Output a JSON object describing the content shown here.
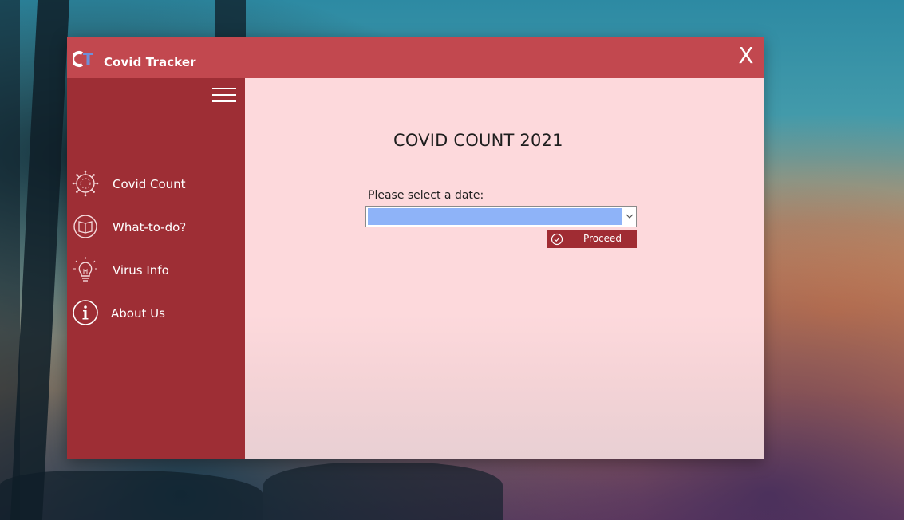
{
  "app": {
    "logo_text": "CT",
    "title": "Covid Tracker",
    "close_label": "X"
  },
  "sidebar": {
    "items": [
      {
        "label": "Covid Count",
        "icon": "virus-icon"
      },
      {
        "label": "What-to-do?",
        "icon": "book-icon"
      },
      {
        "label": "Virus Info",
        "icon": "lightbulb-icon"
      },
      {
        "label": "About Us",
        "icon": "info-icon"
      }
    ]
  },
  "main": {
    "title": "COVID COUNT 2021",
    "date_label": "Please select a date:",
    "date_value": "",
    "proceed_label": "Proceed"
  },
  "colors": {
    "titlebar": "#c2484f",
    "sidebar": "#9e2e35",
    "content": "#fdd9dc",
    "button": "#a02c33",
    "selection": "#8eb3f8"
  }
}
